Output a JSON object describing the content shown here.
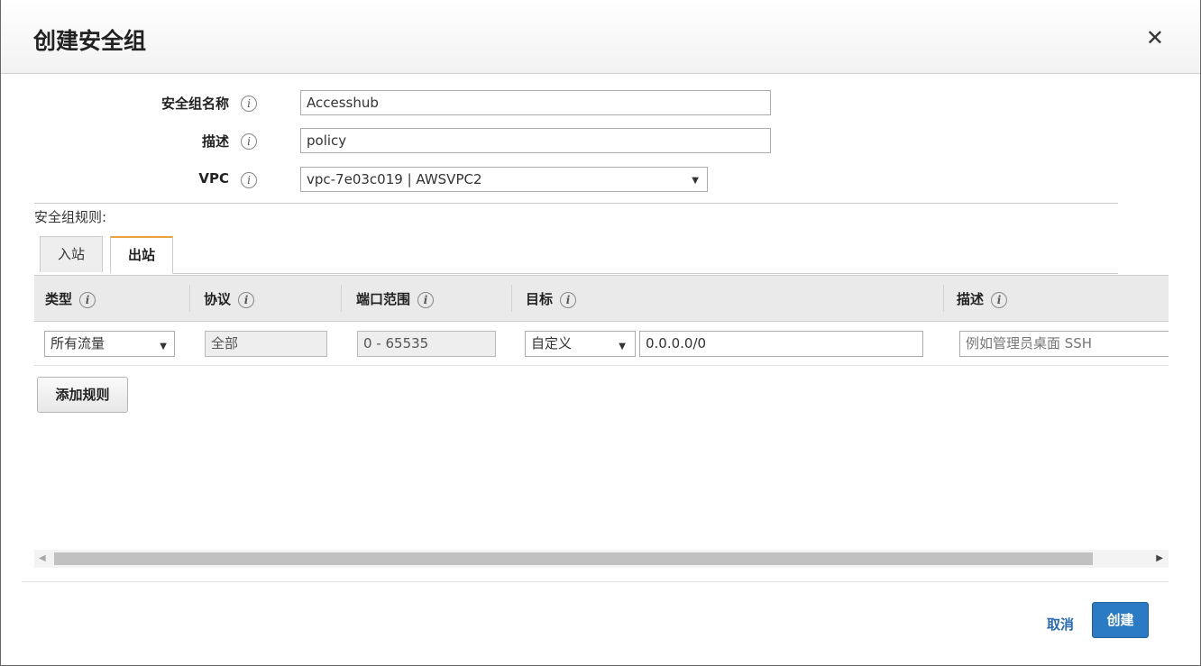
{
  "dialog": {
    "title": "创建安全组",
    "close_glyph": "✕"
  },
  "form": {
    "name": {
      "label": "安全组名称",
      "value": "Accesshub"
    },
    "description": {
      "label": "描述",
      "value": "policy"
    },
    "vpc": {
      "label": "VPC",
      "value": "vpc-7e03c019 | AWSVPC2"
    },
    "info_glyph": "i"
  },
  "rules": {
    "label": "安全组规则:",
    "tabs": [
      {
        "label": "入站",
        "active": false
      },
      {
        "label": "出站",
        "active": true
      }
    ],
    "columns": [
      "类型",
      "协议",
      "端口范围",
      "目标",
      "描述"
    ],
    "rows": [
      {
        "type": "所有流量",
        "protocol": "全部",
        "port_range": "0 - 65535",
        "target_type": "自定义",
        "target_value": "0.0.0.0/0",
        "description_placeholder": "例如管理员桌面 SSH"
      }
    ],
    "add_rule_label": "添加规则"
  },
  "footer": {
    "cancel_label": "取消",
    "create_label": "创建"
  },
  "icons": {
    "select_arrow": "▼",
    "scroll_left": "◀",
    "scroll_right": "▶"
  },
  "colors": {
    "accent_tab": "#e8a33d",
    "primary_button": "#2b7ac4",
    "link": "#2a6bb5"
  }
}
